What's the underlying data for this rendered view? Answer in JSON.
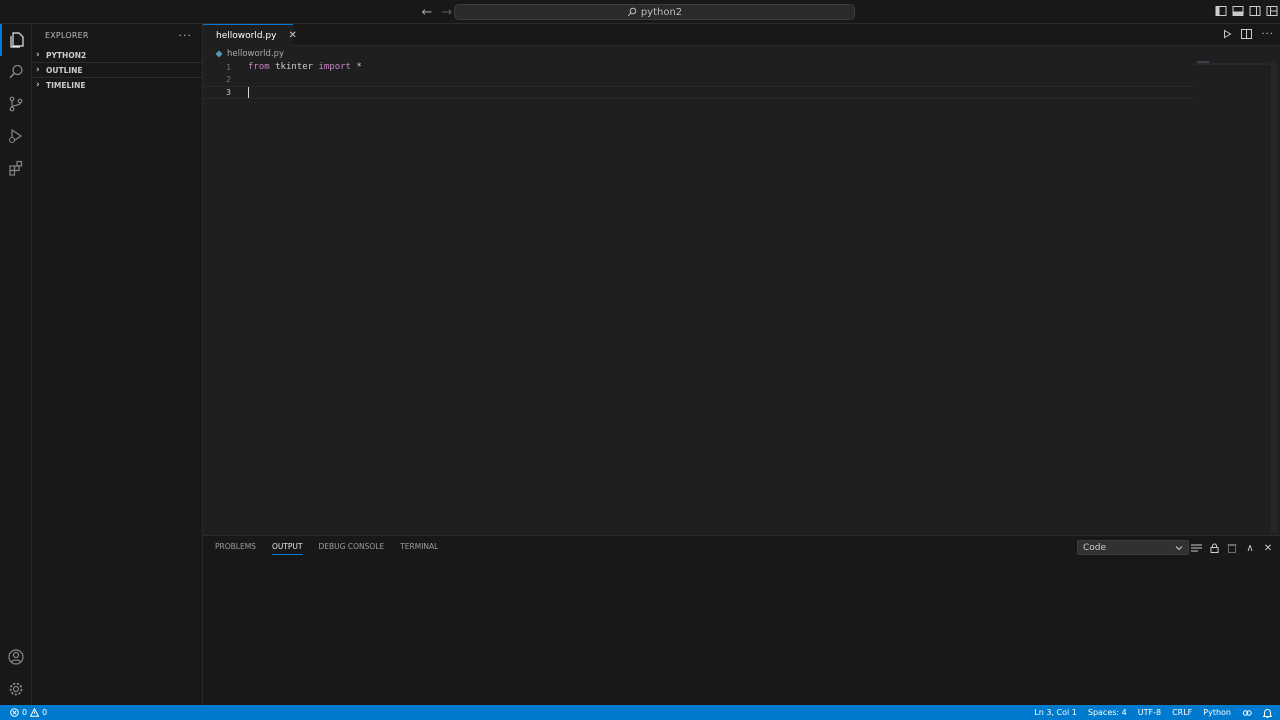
{
  "titlebar": {
    "search_text": "python2"
  },
  "sidebar": {
    "title": "EXPLORER",
    "more": "···",
    "sections": [
      {
        "label": "PYTHON2"
      },
      {
        "label": "OUTLINE"
      },
      {
        "label": "TIMELINE"
      }
    ]
  },
  "editor": {
    "tab_label": "helloworld.py",
    "breadcrumb": "helloworld.py",
    "lines": [
      {
        "num": "1",
        "keyword1": "from",
        "module": "tkinter",
        "keyword2": "import",
        "rest": "*"
      },
      {
        "num": "2"
      },
      {
        "num": "3"
      }
    ]
  },
  "panel": {
    "tabs": [
      "PROBLEMS",
      "OUTPUT",
      "DEBUG CONSOLE",
      "TERMINAL"
    ],
    "active_tab": "OUTPUT",
    "channel": "Code"
  },
  "statusbar": {
    "errors": "0",
    "warnings": "0",
    "position": "Ln 3, Col 1",
    "spaces": "Spaces: 4",
    "encoding": "UTF-8",
    "eol": "CRLF",
    "language": "Python"
  },
  "colors": {
    "accent": "#0078d4",
    "statusbar": "#007acc",
    "keyword": "#c586c0",
    "file_icon": "#519aba"
  }
}
